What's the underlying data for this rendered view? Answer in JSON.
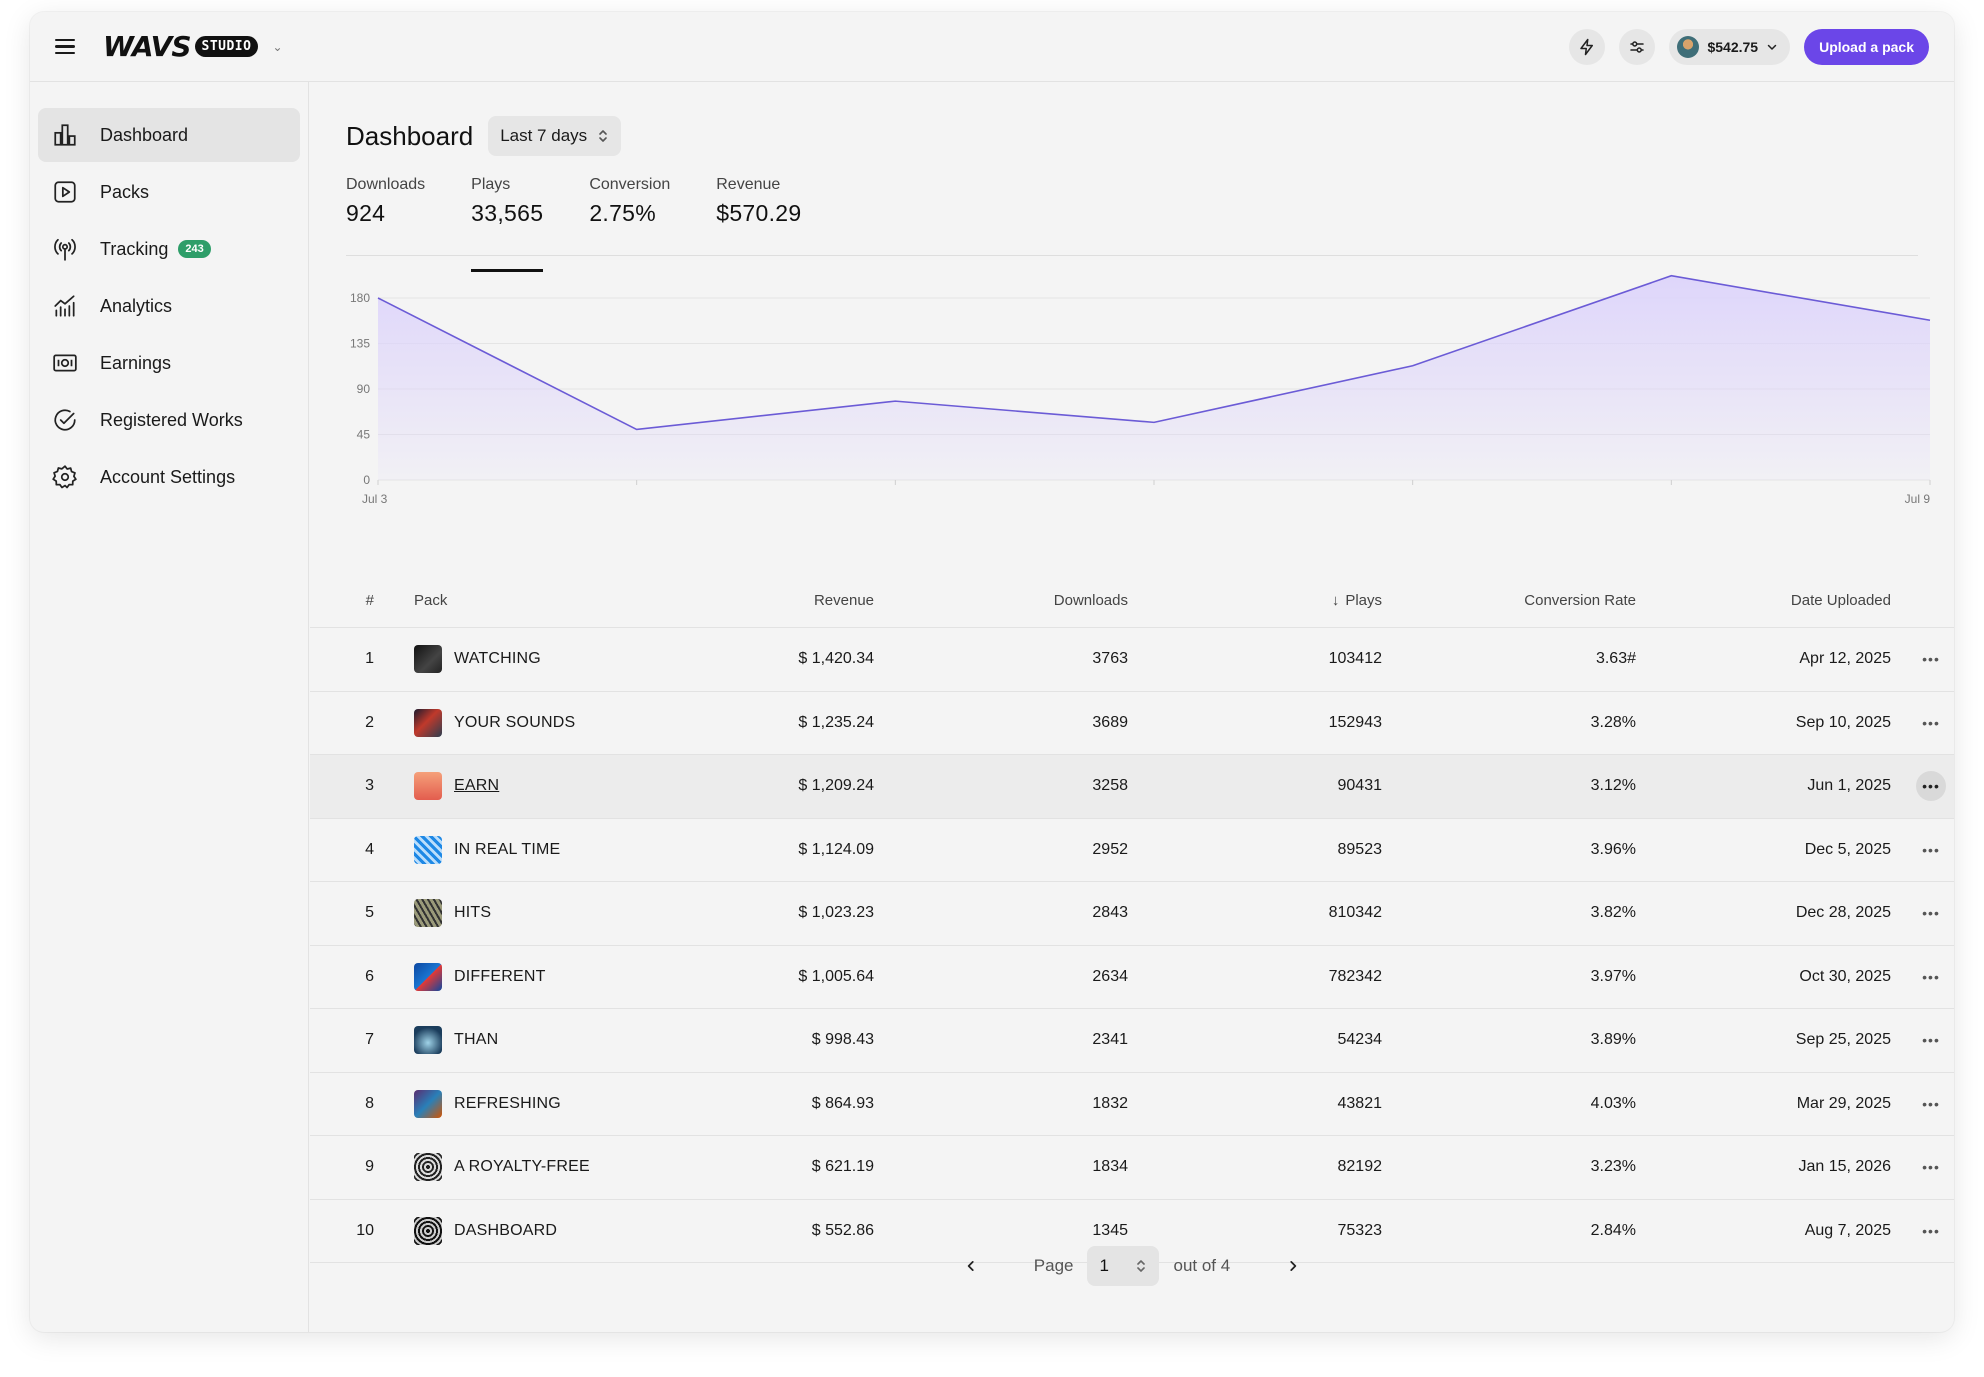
{
  "header": {
    "logo_main": "WAVS",
    "logo_badge": "STUDIO",
    "balance": "$542.75",
    "upload_label": "Upload a pack"
  },
  "sidebar": {
    "items": [
      {
        "label": "Dashboard",
        "icon": "bar-chart-icon",
        "active": true
      },
      {
        "label": "Packs",
        "icon": "play-square-icon"
      },
      {
        "label": "Tracking",
        "icon": "broadcast-icon",
        "badge": "243"
      },
      {
        "label": "Analytics",
        "icon": "analytics-icon"
      },
      {
        "label": "Earnings",
        "icon": "banknote-icon"
      },
      {
        "label": "Registered Works",
        "icon": "check-circle-icon"
      },
      {
        "label": "Account Settings",
        "icon": "gear-icon"
      }
    ]
  },
  "page": {
    "title": "Dashboard",
    "range": "Last 7 days"
  },
  "metrics": [
    {
      "label": "Downloads",
      "value": "924"
    },
    {
      "label": "Plays",
      "value": "33,565",
      "active": true
    },
    {
      "label": "Conversion",
      "value": "2.75%"
    },
    {
      "label": "Revenue",
      "value": "$570.29"
    }
  ],
  "chart_data": {
    "type": "area",
    "x": [
      "Jul 3",
      "Jul 4",
      "Jul 5",
      "Jul 6",
      "Jul 7",
      "Jul 8",
      "Jul 9"
    ],
    "x_tick_labels": [
      "Jul 3",
      "Jul 9"
    ],
    "series": [
      {
        "values": [
          180,
          50,
          78,
          57,
          113,
          202,
          158
        ]
      }
    ],
    "yticks": [
      0,
      45,
      90,
      135,
      180
    ],
    "ylim": [
      0,
      180
    ],
    "accent": "#6b5bd6",
    "fill": "#ddd4fb",
    "grid": true
  },
  "table": {
    "headers": {
      "num": "#",
      "pack": "Pack",
      "revenue": "Revenue",
      "downloads": "Downloads",
      "plays": "Plays",
      "conversion": "Conversion Rate",
      "date": "Date Uploaded"
    },
    "rows": [
      {
        "num": "1",
        "pack": "WATCHING",
        "revenue": "$ 1,420.34",
        "downloads": "3763",
        "plays": "103412",
        "conversion": "3.63#",
        "date": "Apr 12, 2025"
      },
      {
        "num": "2",
        "pack": "YOUR SOUNDS",
        "revenue": "$ 1,235.24",
        "downloads": "3689",
        "plays": "152943",
        "conversion": "3.28%",
        "date": "Sep 10, 2025"
      },
      {
        "num": "3",
        "pack": "EARN",
        "revenue": "$ 1,209.24",
        "downloads": "3258",
        "plays": "90431",
        "conversion": "3.12%",
        "date": "Jun 1, 2025"
      },
      {
        "num": "4",
        "pack": "IN REAL TIME",
        "revenue": "$ 1,124.09",
        "downloads": "2952",
        "plays": "89523",
        "conversion": "3.96%",
        "date": "Dec 5, 2025"
      },
      {
        "num": "5",
        "pack": "HITS",
        "revenue": "$ 1,023.23",
        "downloads": "2843",
        "plays": "810342",
        "conversion": "3.82%",
        "date": "Dec 28, 2025"
      },
      {
        "num": "6",
        "pack": "DIFFERENT",
        "revenue": "$ 1,005.64",
        "downloads": "2634",
        "plays": "782342",
        "conversion": "3.97%",
        "date": "Oct 30, 2025"
      },
      {
        "num": "7",
        "pack": "THAN",
        "revenue": "$ 998.43",
        "downloads": "2341",
        "plays": "54234",
        "conversion": "3.89%",
        "date": "Sep 25, 2025"
      },
      {
        "num": "8",
        "pack": "REFRESHING",
        "revenue": "$ 864.93",
        "downloads": "1832",
        "plays": "43821",
        "conversion": "4.03%",
        "date": "Mar 29, 2025"
      },
      {
        "num": "9",
        "pack": "A ROYALTY-FREE",
        "revenue": "$ 621.19",
        "downloads": "1834",
        "plays": "82192",
        "conversion": "3.23%",
        "date": "Jan 15, 2026"
      },
      {
        "num": "10",
        "pack": "DASHBOARD",
        "revenue": "$ 552.86",
        "downloads": "1345",
        "plays": "75323",
        "conversion": "2.84%",
        "date": "Aug 7, 2025"
      }
    ]
  },
  "pagination": {
    "page_label": "Page",
    "current": "1",
    "total_label": "out of 4"
  }
}
